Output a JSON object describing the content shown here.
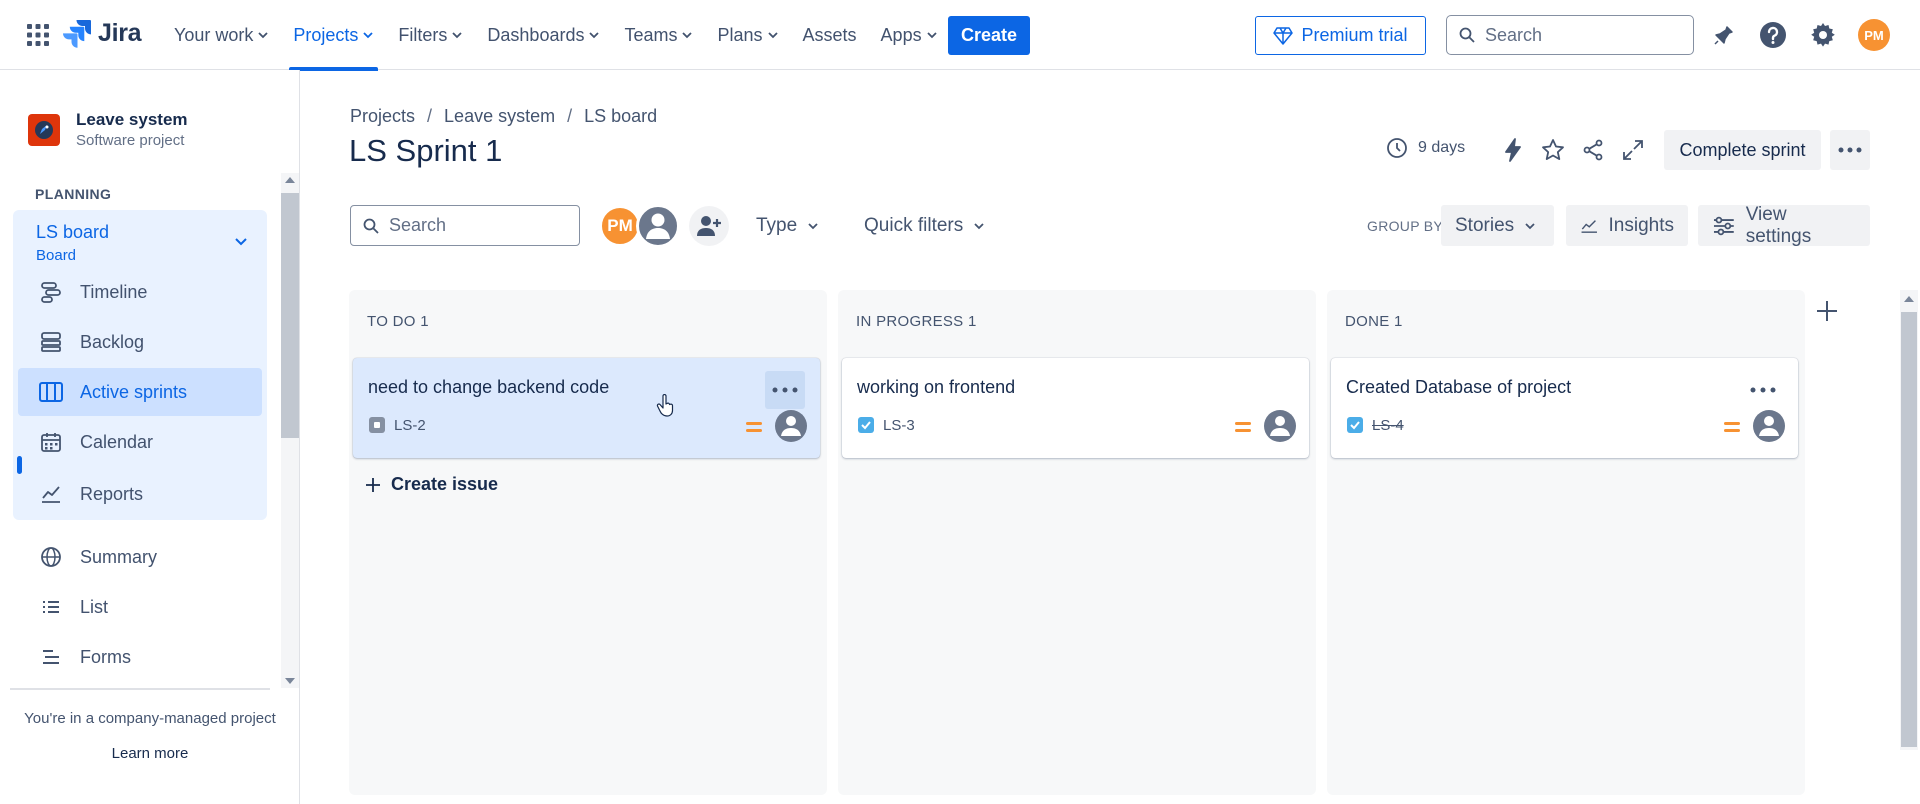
{
  "nav": {
    "logo": "Jira",
    "items": [
      {
        "label": "Your work",
        "dropdown": true,
        "active": false
      },
      {
        "label": "Projects",
        "dropdown": true,
        "active": true
      },
      {
        "label": "Filters",
        "dropdown": true,
        "active": false
      },
      {
        "label": "Dashboards",
        "dropdown": true,
        "active": false
      },
      {
        "label": "Teams",
        "dropdown": true,
        "active": false
      },
      {
        "label": "Plans",
        "dropdown": true,
        "active": false
      },
      {
        "label": "Assets",
        "dropdown": false,
        "active": false
      },
      {
        "label": "Apps",
        "dropdown": true,
        "active": false
      }
    ],
    "create_label": "Create",
    "premium_label": "Premium trial",
    "search_placeholder": "Search",
    "avatar_initials": "PM",
    "accent": "#0c66e4"
  },
  "sidebar": {
    "project_name": "Leave system",
    "project_type": "Software project",
    "planning_heading": "PLANNING",
    "board_title": "LS board",
    "board_subtitle": "Board",
    "planning_items": [
      {
        "label": "Timeline",
        "icon": "timeline-icon"
      },
      {
        "label": "Backlog",
        "icon": "backlog-icon"
      },
      {
        "label": "Active sprints",
        "icon": "active-sprints-icon",
        "active": true
      },
      {
        "label": "Calendar",
        "icon": "calendar-icon"
      },
      {
        "label": "Reports",
        "icon": "reports-icon"
      }
    ],
    "other_items": [
      {
        "label": "Summary",
        "icon": "globe-icon"
      },
      {
        "label": "List",
        "icon": "list-icon"
      },
      {
        "label": "Forms",
        "icon": "forms-icon"
      }
    ],
    "company_note": "You're in a company-managed project",
    "learn_more": "Learn more"
  },
  "header": {
    "breadcrumb": [
      "Projects",
      "Leave system",
      "LS board"
    ],
    "title": "LS Sprint 1",
    "days_remaining": "9 days",
    "complete_sprint_label": "Complete sprint"
  },
  "toolbar": {
    "search_placeholder": "Search",
    "avatar_initials": "PM",
    "type_label": "Type",
    "quick_filters_label": "Quick filters",
    "group_by_label": "GROUP BY",
    "group_by_value": "Stories",
    "insights_label": "Insights",
    "view_settings_label": "View settings"
  },
  "board": {
    "columns": [
      {
        "header": "TO DO 1",
        "cards": [
          {
            "title": "need to change backend code",
            "key": "LS-2",
            "type": "task-open",
            "selected": true
          }
        ]
      },
      {
        "header": "IN PROGRESS 1",
        "cards": [
          {
            "title": "working on frontend",
            "key": "LS-3",
            "type": "task-checked",
            "selected": false
          }
        ]
      },
      {
        "header": "DONE 1",
        "cards": [
          {
            "title": "Created Database of project",
            "key": "LS-4",
            "type": "task-checked",
            "done": true,
            "selected": false
          }
        ]
      }
    ],
    "create_issue_label": "Create issue",
    "priority_color": "#f79232"
  }
}
